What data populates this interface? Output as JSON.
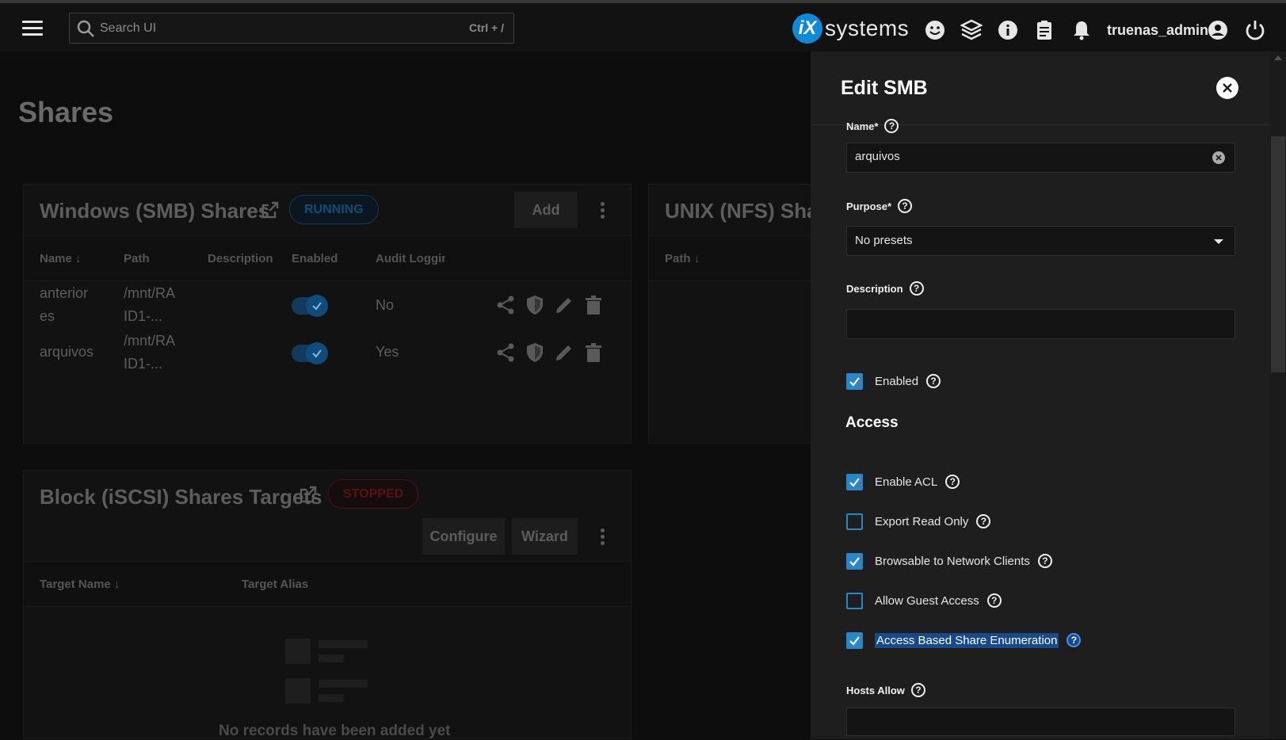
{
  "topbar": {
    "search_placeholder": "Search UI",
    "search_shortcut": "Ctrl + /",
    "brand_ix": "iX",
    "brand_text": "systems",
    "username": "truenas_admin"
  },
  "page": {
    "title": "Shares",
    "smb_card": {
      "title": "Windows (SMB) Shares",
      "status": "RUNNING",
      "add_label": "Add",
      "columns": [
        "Name",
        "Path",
        "Description",
        "Enabled",
        "Audit Logging"
      ],
      "rows": [
        {
          "name": "anterior\nes",
          "path": "/mnt/RA\nID1-...",
          "description": "",
          "enabled": true,
          "audit": "No"
        },
        {
          "name": "arquivos",
          "path": "/mnt/RA\nID1-...",
          "description": "",
          "enabled": true,
          "audit": "Yes"
        }
      ]
    },
    "nfs_card": {
      "title": "UNIX (NFS) Shares",
      "columns": [
        "Path"
      ]
    },
    "iscsi_card": {
      "title": "Block (iSCSI) Shares Targets",
      "status": "STOPPED",
      "configure_label": "Configure",
      "wizard_label": "Wizard",
      "columns": [
        "Target Name",
        "Target Alias"
      ],
      "empty_text": "No records have been added yet"
    }
  },
  "panel": {
    "title": "Edit SMB",
    "name_label": "Name",
    "name_value": "arquivos",
    "purpose_label": "Purpose",
    "purpose_value": "No presets",
    "description_label": "Description",
    "description_value": "",
    "enabled_label": "Enabled",
    "enabled_checked": true,
    "access_title": "Access",
    "access_options": [
      {
        "label": "Enable ACL",
        "checked": true
      },
      {
        "label": "Export Read Only",
        "checked": false
      },
      {
        "label": "Browsable to Network Clients",
        "checked": true
      },
      {
        "label": "Allow Guest Access",
        "checked": false
      },
      {
        "label": "Access Based Share Enumeration",
        "checked": true
      }
    ],
    "hosts_allow_label": "Hosts Allow",
    "hosts_allow_value": ""
  },
  "colors": {
    "accent": "#2b86c7",
    "running": "#0b4e78",
    "stopped": "#5a1111"
  }
}
